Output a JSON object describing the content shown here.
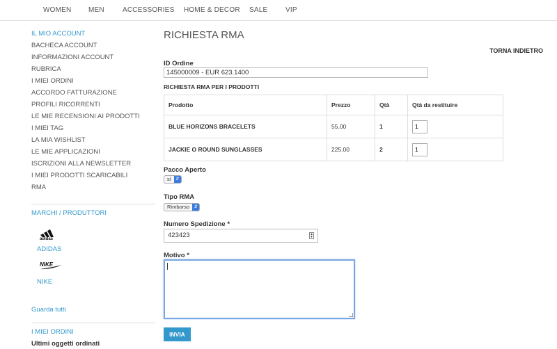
{
  "nav": [
    "WOMEN",
    "MEN",
    "ACCESSORIES",
    "HOME & DECOR",
    "SALE",
    "VIP"
  ],
  "sidebar": {
    "title": "IL MIO ACCOUNT",
    "items": [
      "BACHECA ACCOUNT",
      "INFORMAZIONI ACCOUNT",
      "RUBRICA",
      "I MIEI ORDINI",
      "ACCORDO FATTURAZIONE",
      "PROFILI RICORRENTI",
      "LE MIE RECENSIONI AI PRODOTTI",
      "I MIEI TAG",
      "LA MIA WISHLIST",
      "LE MIE APPLICAZIONI",
      "ISCRIZIONI ALLA NEWSLETTER",
      "I MIEI PRODOTTI SCARICABILI",
      "RMA"
    ],
    "brands_title": "MARCHI / PRODUTTORI",
    "brands": [
      "ADIDAS",
      "NIKE"
    ],
    "see_all": "Guarda tutti",
    "orders_title": "I MIEI ORDINI",
    "recent_title": "Ultimi oggetti ordinati"
  },
  "main": {
    "title": "RICHIESTA RMA",
    "back": "TORNA INDIETRO",
    "order_label": "ID Ordine",
    "order_value": "145000009 - EUR 623.1400",
    "section_title": "RICHIESTA RMA PER I PRODOTTI",
    "table": {
      "headers": [
        "Prodotto",
        "Prezzo",
        "Qtà",
        "Qtà da restituire"
      ],
      "rows": [
        {
          "product": "BLUE HORIZONS BRACELETS",
          "price": "55.00",
          "qty": "1",
          "return_qty": "1"
        },
        {
          "product": "JACKIE O ROUND SUNGLASSES",
          "price": "225.00",
          "qty": "2",
          "return_qty": "1"
        }
      ]
    },
    "package_label": "Pacco Aperto",
    "package_value": "sì",
    "rma_type_label": "Tipo RMA",
    "rma_type_value": "Rimborso",
    "tracking_label": "Numero Spedizione *",
    "tracking_value": "423423",
    "reason_label": "Motivo *",
    "submit": "INVIA"
  },
  "colors": {
    "accent": "#3399cc",
    "focus": "#7aa7e0"
  }
}
